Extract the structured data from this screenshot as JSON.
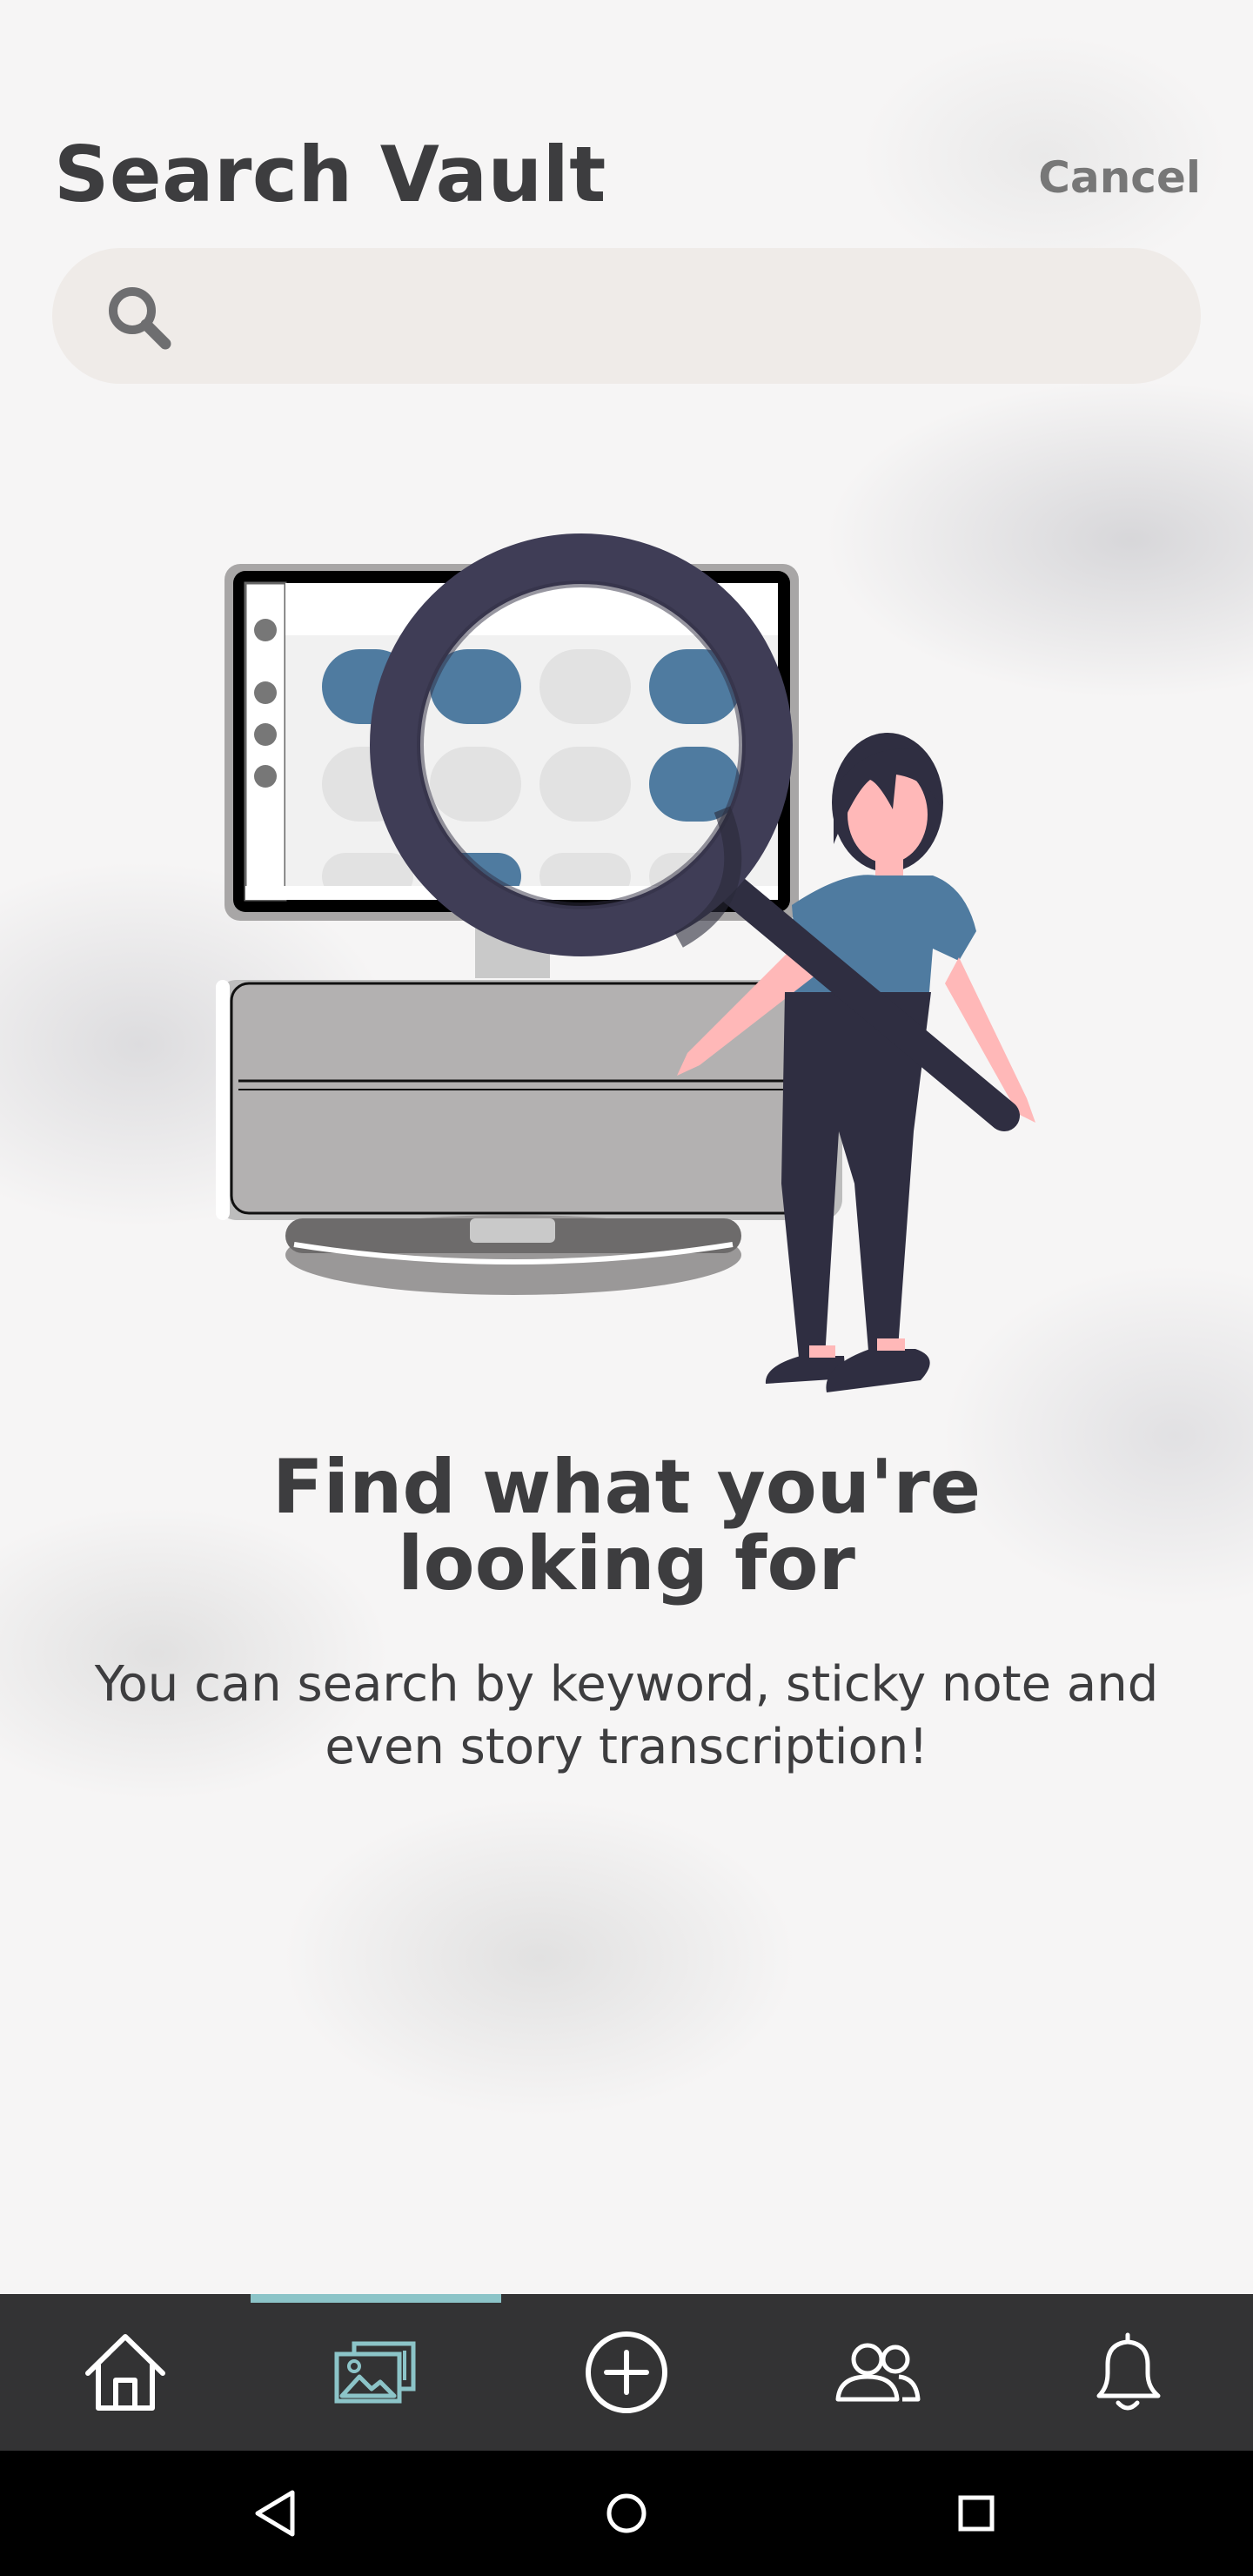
{
  "header": {
    "title": "Search Vault",
    "cancel_label": "Cancel"
  },
  "search": {
    "value": "",
    "placeholder": "",
    "icon": "search-icon"
  },
  "empty_state": {
    "headline_line1": "Find what you're",
    "headline_line2": "looking for",
    "description": "You can search by keyword, sticky note and even story transcription!"
  },
  "tabbar": {
    "active_tab": "vault",
    "tabs": [
      {
        "id": "home",
        "icon": "home-icon"
      },
      {
        "id": "vault",
        "icon": "photos-icon"
      },
      {
        "id": "add",
        "icon": "plus-circle-icon"
      },
      {
        "id": "people",
        "icon": "people-icon"
      },
      {
        "id": "notifications",
        "icon": "bell-icon"
      }
    ]
  },
  "system_nav": {
    "buttons": [
      "back-icon",
      "home-circle-icon",
      "recents-icon"
    ]
  },
  "colors": {
    "accent": "#8cc4c8",
    "tabbar_bg": "#333334",
    "search_bg": "#efebe8",
    "illustration_blue": "#4f7ba0",
    "illustration_dark": "#3f3d56",
    "text": "#3d3d3f"
  }
}
